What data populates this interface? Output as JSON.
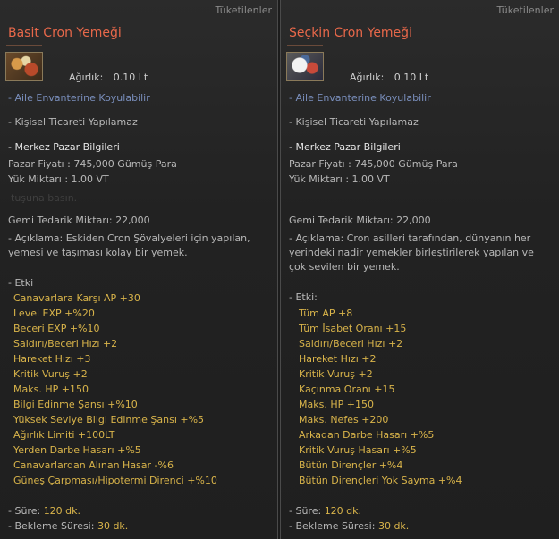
{
  "left": {
    "category": "Tüketilenler",
    "title": "Basit Cron Yemeği",
    "icon": "food-plate-icon",
    "weight_label": "Ağırlık:",
    "weight_value": "0.10 Lt",
    "family_inventory": "- Aile Envanterine Koyulabilir",
    "no_trade": "- Kişisel Ticareti Yapılamaz",
    "market_header": "- Merkez Pazar Bilgileri",
    "market_price": "Pazar Fiyatı :  745,000 Gümüş Para",
    "load": "Yük Miktarı : 1.00 VT",
    "bg_hint": "tuşuna basın.",
    "ship_supply": "Gemi Tedarik Miktarı: 22,000",
    "description": "- Açıklama: Eskiden Cron Şövalyeleri için yapılan, yemesi ve taşıması kolay bir yemek.",
    "effect_header": "- Etki",
    "effects": [
      "Canavarlara Karşı AP +30",
      "Level EXP +%20",
      "Beceri EXP +%10",
      "Saldırı/Beceri Hızı +2",
      "Hareket Hızı +3",
      "Kritik Vuruş +2",
      "Maks. HP +150",
      "Bilgi Edinme Şansı +%10",
      "Yüksek Seviye Bilgi Edinme Şansı +%5",
      "Ağırlık Limiti +100LT",
      "Yerden Darbe Hasarı +%5",
      "Canavarlardan Alınan Hasar -%6",
      "Güneş Çarpması/Hipotermi Direnci +%10"
    ],
    "duration_label": "- Süre:",
    "duration_value": "120 dk.",
    "cooldown_label": "- Bekleme Süresi:",
    "cooldown_value": "30 dk."
  },
  "right": {
    "category": "Tüketilenler",
    "title": "Seçkin Cron Yemeği",
    "icon": "food-plate-icon",
    "weight_label": "Ağırlık:",
    "weight_value": "0.10 Lt",
    "family_inventory": "- Aile Envanterine Koyulabilir",
    "no_trade": "- Kişisel Ticareti Yapılamaz",
    "market_header": "- Merkez Pazar Bilgileri",
    "market_price": "Pazar Fiyatı :  745,000 Gümüş Para",
    "load": "Yük Miktarı : 1.00 VT",
    "ship_supply": "Gemi Tedarik Miktarı: 22,000",
    "description": "- Açıklama: Cron asilleri tarafından, dünyanın her yerindeki nadir yemekler birleştirilerek yapılan ve çok sevilen bir yemek.",
    "effect_header": "- Etki:",
    "effects": [
      "Tüm AP +8",
      "Tüm İsabet Oranı +15",
      "Saldırı/Beceri Hızı +2",
      "Hareket Hızı +2",
      "Kritik Vuruş +2",
      "Kaçınma Oranı +15",
      "Maks. HP +150",
      "Maks. Nefes +200",
      "Arkadan Darbe Hasarı +%5",
      "Kritik Vuruş Hasarı +%5",
      "Bütün Dirençler +%4",
      "Bütün Direnç​leri Yok Sayma +%4"
    ],
    "duration_label": "- Süre:",
    "duration_value": "120 dk.",
    "cooldown_label": "- Bekleme Süresi:",
    "cooldown_value": "30 dk."
  }
}
